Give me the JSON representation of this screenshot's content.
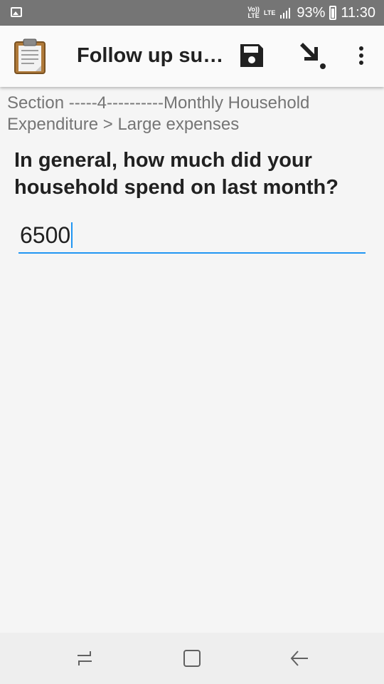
{
  "statusbar": {
    "volte_top": "Vo))",
    "volte_bottom": "LTE",
    "lte": "LTE",
    "battery_percent": "93%",
    "time": "11:30"
  },
  "toolbar": {
    "title": "Follow up su…",
    "app_icon": "clipboard-icon",
    "save_icon": "save-icon",
    "jump_icon": "jump-arrow-icon",
    "more_icon": "more-vert-icon"
  },
  "form": {
    "breadcrumb": "Section -----4----------Monthly Household Expenditure > Large expenses",
    "question": "In general, how much did your household spend on last month?",
    "answer_value": "6500",
    "accent_color": "#2196f3"
  },
  "navbar": {
    "recent_icon": "recent-apps-icon",
    "home_icon": "home-icon",
    "back_icon": "back-icon"
  }
}
